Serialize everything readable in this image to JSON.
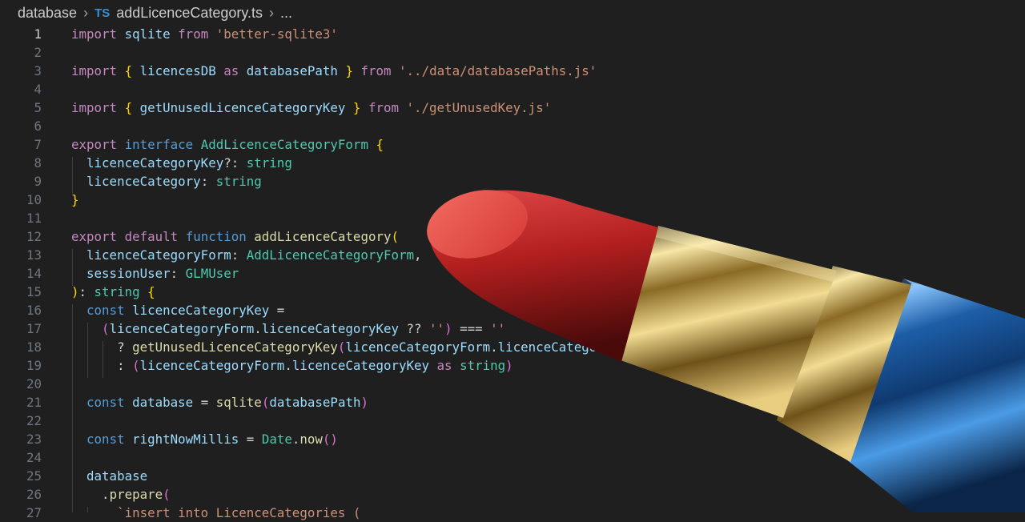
{
  "breadcrumb": {
    "folder": "database",
    "file_icon": "TS",
    "file": "addLicenceCategory.ts",
    "more": "..."
  },
  "editor": {
    "active_line": 1,
    "lines": [
      {
        "n": "1",
        "t": [
          [
            "import",
            "kw-c"
          ],
          [
            " sqlite ",
            "var"
          ],
          [
            "from",
            "kw-c"
          ],
          [
            " ",
            ""
          ],
          [
            "'better-sqlite3'",
            "str"
          ]
        ]
      },
      {
        "n": "2",
        "t": []
      },
      {
        "n": "3",
        "t": [
          [
            "import",
            "kw-c"
          ],
          [
            " ",
            ""
          ],
          [
            "{",
            "p1"
          ],
          [
            " licencesDB ",
            "var"
          ],
          [
            "as",
            "kw-c"
          ],
          [
            " databasePath ",
            "var"
          ],
          [
            "}",
            "p1"
          ],
          [
            " ",
            ""
          ],
          [
            "from",
            "kw-c"
          ],
          [
            " ",
            ""
          ],
          [
            "'../data/databasePaths.js'",
            "str"
          ]
        ]
      },
      {
        "n": "4",
        "t": []
      },
      {
        "n": "5",
        "t": [
          [
            "import",
            "kw-c"
          ],
          [
            " ",
            ""
          ],
          [
            "{",
            "p1"
          ],
          [
            " getUnusedLicenceCategoryKey ",
            "var"
          ],
          [
            "}",
            "p1"
          ],
          [
            " ",
            ""
          ],
          [
            "from",
            "kw-c"
          ],
          [
            " ",
            ""
          ],
          [
            "'./getUnusedKey.js'",
            "str"
          ]
        ]
      },
      {
        "n": "6",
        "t": []
      },
      {
        "n": "7",
        "t": [
          [
            "export",
            "kw-c"
          ],
          [
            " ",
            ""
          ],
          [
            "interface",
            "kw-b"
          ],
          [
            " ",
            ""
          ],
          [
            "AddLicenceCategoryForm",
            "ty"
          ],
          [
            " ",
            ""
          ],
          [
            "{",
            "p1"
          ]
        ]
      },
      {
        "n": "8",
        "t": [
          [
            "  licenceCategoryKey",
            "var"
          ],
          [
            "?: ",
            "op"
          ],
          [
            "string",
            "ty"
          ]
        ]
      },
      {
        "n": "9",
        "t": [
          [
            "  licenceCategory",
            "var"
          ],
          [
            ": ",
            "op"
          ],
          [
            "string",
            "ty"
          ]
        ]
      },
      {
        "n": "10",
        "t": [
          [
            "}",
            "p1"
          ]
        ]
      },
      {
        "n": "11",
        "t": []
      },
      {
        "n": "12",
        "t": [
          [
            "export",
            "kw-c"
          ],
          [
            " ",
            ""
          ],
          [
            "default",
            "kw-c"
          ],
          [
            " ",
            ""
          ],
          [
            "function",
            "kw-b"
          ],
          [
            " ",
            ""
          ],
          [
            "addLicenceCategory",
            "fn"
          ],
          [
            "(",
            "p1"
          ]
        ]
      },
      {
        "n": "13",
        "t": [
          [
            "  licenceCategoryForm",
            "var"
          ],
          [
            ": ",
            "op"
          ],
          [
            "AddLicenceCategoryForm",
            "ty"
          ],
          [
            ",",
            "op"
          ]
        ]
      },
      {
        "n": "14",
        "t": [
          [
            "  sessionUser",
            "var"
          ],
          [
            ": ",
            "op"
          ],
          [
            "GLMUser",
            "ty"
          ]
        ]
      },
      {
        "n": "15",
        "t": [
          [
            ")",
            "p1"
          ],
          [
            ": ",
            "op"
          ],
          [
            "string",
            "ty"
          ],
          [
            " ",
            ""
          ],
          [
            "{",
            "p1"
          ]
        ]
      },
      {
        "n": "16",
        "t": [
          [
            "  ",
            ""
          ],
          [
            "const",
            "kw-b"
          ],
          [
            " licenceCategoryKey",
            "var"
          ],
          [
            " =",
            "op"
          ]
        ]
      },
      {
        "n": "17",
        "t": [
          [
            "    ",
            ""
          ],
          [
            "(",
            "p2"
          ],
          [
            "licenceCategoryForm",
            "var"
          ],
          [
            ".",
            "op"
          ],
          [
            "licenceCategoryKey",
            "var"
          ],
          [
            " ?? ",
            "op"
          ],
          [
            "''",
            "str"
          ],
          [
            ")",
            "p2"
          ],
          [
            " === ",
            "op"
          ],
          [
            "''",
            "str"
          ]
        ]
      },
      {
        "n": "18",
        "t": [
          [
            "      ? ",
            "op"
          ],
          [
            "getUnusedLicenceCategoryKey",
            "fn"
          ],
          [
            "(",
            "p2"
          ],
          [
            "licenceCategoryForm",
            "var"
          ],
          [
            ".",
            "op"
          ],
          [
            "licenceCategory",
            "var"
          ],
          [
            ")",
            "p2"
          ]
        ]
      },
      {
        "n": "19",
        "t": [
          [
            "      : ",
            "op"
          ],
          [
            "(",
            "p2"
          ],
          [
            "licenceCategoryForm",
            "var"
          ],
          [
            ".",
            "op"
          ],
          [
            "licenceCategoryKey",
            "var"
          ],
          [
            " ",
            ""
          ],
          [
            "as",
            "kw-c"
          ],
          [
            " ",
            ""
          ],
          [
            "string",
            "ty"
          ],
          [
            ")",
            "p2"
          ]
        ]
      },
      {
        "n": "20",
        "t": []
      },
      {
        "n": "21",
        "t": [
          [
            "  ",
            ""
          ],
          [
            "const",
            "kw-b"
          ],
          [
            " database",
            "var"
          ],
          [
            " = ",
            "op"
          ],
          [
            "sqlite",
            "fn"
          ],
          [
            "(",
            "p2"
          ],
          [
            "databasePath",
            "var"
          ],
          [
            ")",
            "p2"
          ]
        ]
      },
      {
        "n": "22",
        "t": []
      },
      {
        "n": "23",
        "t": [
          [
            "  ",
            ""
          ],
          [
            "const",
            "kw-b"
          ],
          [
            " rightNowMillis",
            "var"
          ],
          [
            " = ",
            "op"
          ],
          [
            "Date",
            "ty"
          ],
          [
            ".",
            "op"
          ],
          [
            "now",
            "fn"
          ],
          [
            "()",
            "p2"
          ]
        ]
      },
      {
        "n": "24",
        "t": []
      },
      {
        "n": "25",
        "t": [
          [
            "  database",
            "var"
          ]
        ]
      },
      {
        "n": "26",
        "t": [
          [
            "    .",
            "op"
          ],
          [
            "prepare",
            "fn"
          ],
          [
            "(",
            "p2"
          ]
        ]
      },
      {
        "n": "27",
        "t": [
          [
            "      `insert into LicenceCategories (",
            "str"
          ]
        ]
      }
    ]
  },
  "overlay_image": {
    "subject": "lipstick",
    "colors": {
      "bullet": "#c72a2a",
      "gold": "#d4b35a",
      "case": "#1c5ea8"
    }
  }
}
